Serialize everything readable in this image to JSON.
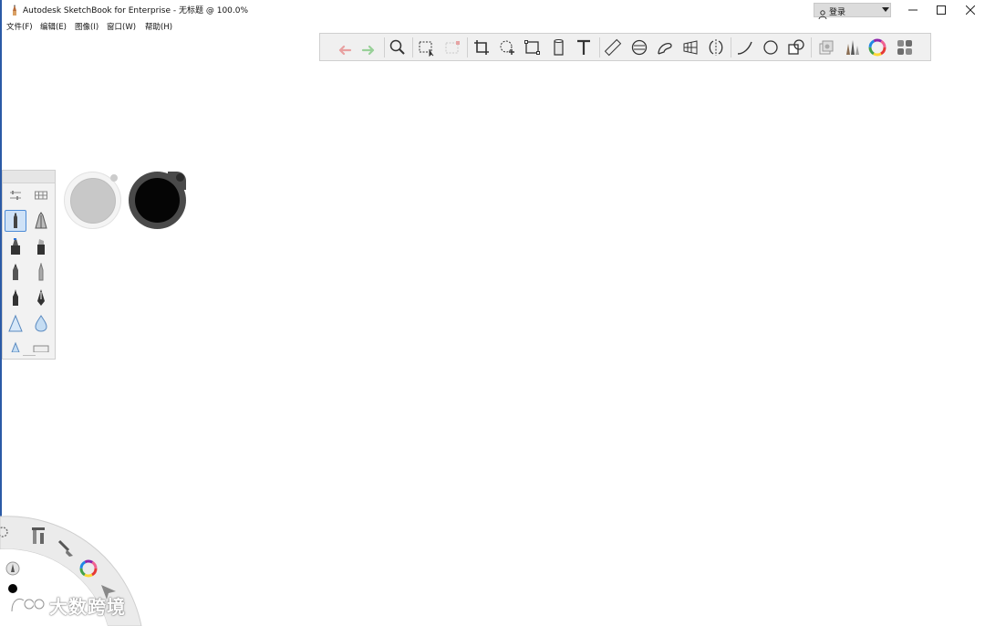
{
  "window": {
    "title": "Autodesk SketchBook for Enterprise - 无标题 @ 100.0%",
    "login_label": "登录",
    "controls": [
      "minimize",
      "maximize",
      "close"
    ]
  },
  "menu": {
    "items": [
      "文件(F)",
      "编辑(E)",
      "图像(I)",
      "窗口(W)",
      "帮助(H)"
    ]
  },
  "toolbar": {
    "tools": [
      {
        "icon": "undo-icon",
        "color": "#e8a0a0"
      },
      {
        "icon": "redo-icon",
        "color": "#98d098"
      },
      {
        "icon": "zoom-icon"
      },
      {
        "icon": "select-icon"
      },
      {
        "icon": "select-disabled-icon"
      },
      {
        "icon": "crop-icon"
      },
      {
        "icon": "transform-icon"
      },
      {
        "icon": "distort-icon"
      },
      {
        "icon": "fill-icon"
      },
      {
        "icon": "text-icon"
      },
      {
        "icon": "ruler-icon"
      },
      {
        "icon": "ellipse-guide-icon"
      },
      {
        "icon": "french-curve-icon"
      },
      {
        "icon": "perspective-icon"
      },
      {
        "icon": "symmetry-icon"
      },
      {
        "icon": "stroke-icon"
      },
      {
        "icon": "circle-icon"
      },
      {
        "icon": "shapes-icon"
      },
      {
        "icon": "layers-icon"
      },
      {
        "icon": "brushes-icon"
      },
      {
        "icon": "color-wheel-icon"
      },
      {
        "icon": "copic-icon"
      }
    ]
  },
  "brush_panel": {
    "brushes": [
      "pencil-icon",
      "ballpoint-pen-icon",
      "marker-icon",
      "chisel-marker-icon",
      "ink-pen-icon",
      "fine-pen-icon",
      "brush-pen-icon",
      "calligraphy-pen-icon",
      "airbrush-icon",
      "water-drop-icon",
      "cone-brush-icon",
      "flat-brush-icon"
    ],
    "selected_index": 0
  },
  "color_pucks": {
    "light_color": "#c8c8c8",
    "dark_color": "#050505"
  },
  "watermark": {
    "text": "大数跨境"
  }
}
